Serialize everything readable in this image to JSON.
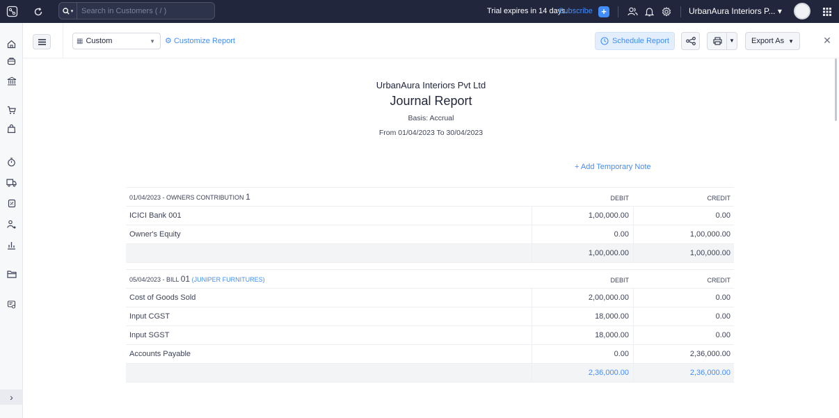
{
  "topbar": {
    "search_placeholder": "Search in Customers ( / )",
    "trial_text": "Trial expires in 14 days.",
    "subscribe_label": "Subscribe",
    "org_name": "UrbanAura Interiors P... ▾",
    "icons": [
      "sidebar-toggle-icon",
      "refresh-icon",
      "search-icon",
      "add-icon",
      "team-icon",
      "bell-icon",
      "gear-icon",
      "avatar",
      "apps-grid-icon"
    ]
  },
  "sidebar": {
    "items": [
      "home-icon",
      "items-icon",
      "banking-icon",
      "sales-icon",
      "purchases-icon",
      "time-tracking-icon",
      "eway-bill-icon",
      "accountant-icon",
      "customers-icon",
      "reports-icon",
      "documents-icon",
      "ewaybill-doc-icon"
    ],
    "expand_label": "›"
  },
  "toolbar": {
    "period_value": "Custom",
    "customize_label": "Customize Report",
    "schedule_label": "Schedule Report",
    "export_label": "Export As"
  },
  "report": {
    "company": "UrbanAura Interiors Pvt Ltd",
    "title": "Journal Report",
    "basis": "Basis: Accrual",
    "date_range": "From 01/04/2023 To 30/04/2023",
    "add_note_label": "+ Add Temporary Note",
    "debit_header": "DEBIT",
    "credit_header": "CREDIT",
    "entries": [
      {
        "date_type": "01/04/2023 - OWNERS CONTRIBUTION",
        "number": "1",
        "link": "",
        "lines": [
          {
            "account": "ICICI Bank 001",
            "debit": "1,00,000.00",
            "credit": "0.00"
          },
          {
            "account": "Owner's Equity",
            "debit": "0.00",
            "credit": "1,00,000.00"
          }
        ],
        "total_debit": "1,00,000.00",
        "total_credit": "1,00,000.00"
      },
      {
        "date_type": "05/04/2023 - BILL",
        "number": "01",
        "link": "(JUNIPER FURNITURES)",
        "lines": [
          {
            "account": "Cost of Goods Sold",
            "debit": "2,00,000.00",
            "credit": "0.00"
          },
          {
            "account": "Input CGST",
            "debit": "18,000.00",
            "credit": "0.00"
          },
          {
            "account": "Input SGST",
            "debit": "18,000.00",
            "credit": "0.00"
          },
          {
            "account": "Accounts Payable",
            "debit": "0.00",
            "credit": "2,36,000.00"
          }
        ],
        "total_debit": "2,36,000.00",
        "total_credit": "2,36,000.00"
      }
    ]
  }
}
